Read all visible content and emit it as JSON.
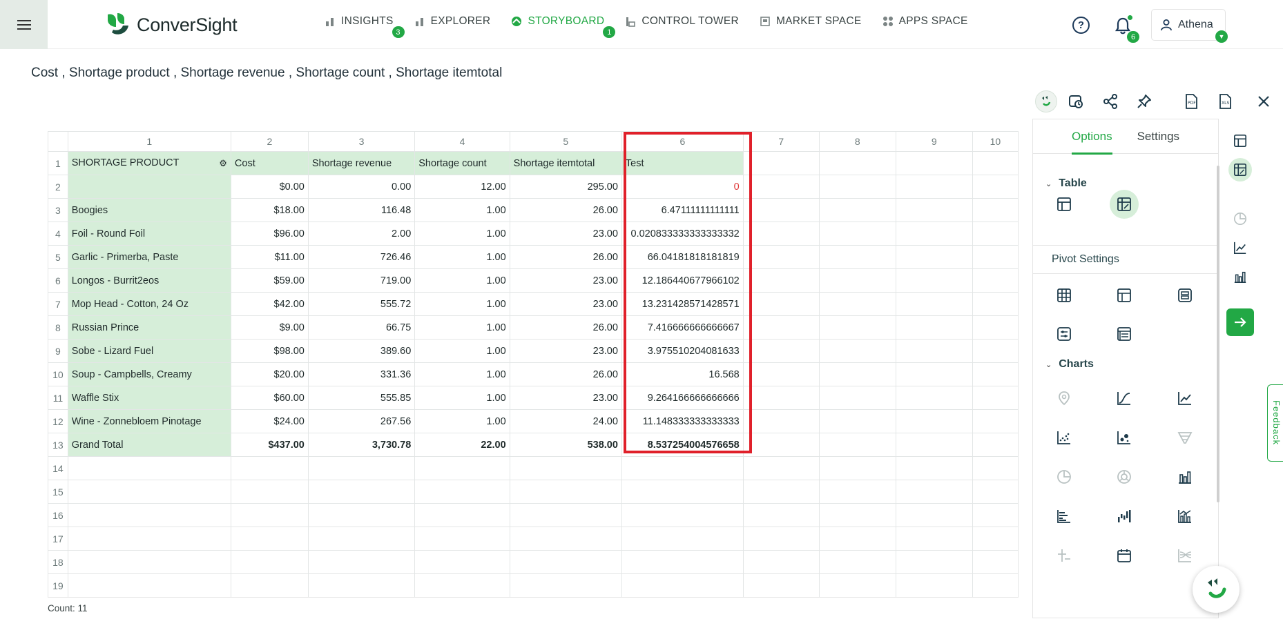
{
  "brand": {
    "name": "ConverSight"
  },
  "nav": [
    {
      "label": "INSIGHTS",
      "badge": "3"
    },
    {
      "label": "EXPLORER"
    },
    {
      "label": "STORYBOARD",
      "badge": "1"
    },
    {
      "label": "CONTROL TOWER"
    },
    {
      "label": "MARKET SPACE"
    },
    {
      "label": "APPS SPACE"
    }
  ],
  "header": {
    "help": "?",
    "notifications": "6",
    "user": "Athena"
  },
  "page": {
    "title": "Cost , Shortage product , Shortage revenue , Shortage count , Shortage itemtotal"
  },
  "grid": {
    "column_numbers": [
      "1",
      "2",
      "3",
      "4",
      "5",
      "6",
      "7",
      "8",
      "9",
      "10"
    ],
    "headers": [
      "SHORTAGE PRODUCT",
      "Cost",
      "Shortage revenue",
      "Shortage count",
      "Shortage itemtotal",
      "Test"
    ],
    "rows": [
      [
        "",
        "$0.00",
        "0.00",
        "12.00",
        "295.00",
        "0"
      ],
      [
        "Boogies",
        "$18.00",
        "116.48",
        "1.00",
        "26.00",
        "6.47111111111111"
      ],
      [
        "Foil - Round Foil",
        "$96.00",
        "2.00",
        "1.00",
        "23.00",
        "0.020833333333333332"
      ],
      [
        "Garlic - Primerba, Paste",
        "$11.00",
        "726.46",
        "1.00",
        "26.00",
        "66.04181818181819"
      ],
      [
        "Longos - Burrit2eos",
        "$59.00",
        "719.00",
        "1.00",
        "23.00",
        "12.186440677966102"
      ],
      [
        "Mop Head - Cotton, 24 Oz",
        "$42.00",
        "555.72",
        "1.00",
        "23.00",
        "13.231428571428571"
      ],
      [
        "Russian Prince",
        "$9.00",
        "66.75",
        "1.00",
        "26.00",
        "7.416666666666667"
      ],
      [
        "Sobe - Lizard Fuel",
        "$98.00",
        "389.60",
        "1.00",
        "23.00",
        "3.975510204081633"
      ],
      [
        "Soup - Campbells, Creamy",
        "$20.00",
        "331.36",
        "1.00",
        "26.00",
        "16.568"
      ],
      [
        "Waffle Stix",
        "$60.00",
        "555.85",
        "1.00",
        "23.00",
        "9.264166666666666"
      ],
      [
        "Wine - Zonnebloem Pinotage",
        "$24.00",
        "267.56",
        "1.00",
        "24.00",
        "11.148333333333333"
      ],
      [
        "Grand Total",
        "$437.00",
        "3,730.78",
        "22.00",
        "538.00",
        "8.537254004576658"
      ]
    ],
    "empty_row_numbers": [
      "14",
      "15",
      "16",
      "17",
      "18",
      "19"
    ],
    "count": "Count: 11"
  },
  "panel": {
    "tabs": [
      "Options",
      "Settings"
    ],
    "table_section": "Table",
    "pivot_section": "Pivot Settings",
    "charts_section": "Charts"
  },
  "feedback": "Feedback",
  "colors": {
    "accent": "#22a845",
    "header_fill": "#d6eed9",
    "highlight": "#e0202a"
  }
}
